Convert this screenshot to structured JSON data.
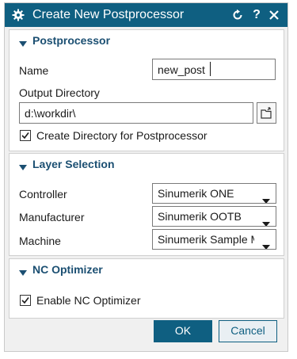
{
  "dialog": {
    "title": "Create New Postprocessor",
    "help_label": "?",
    "accent_color": "#0f5f81"
  },
  "postprocessor": {
    "section_title": "Postprocessor",
    "name_label": "Name",
    "name_value": "new_post",
    "output_dir_label": "Output Directory",
    "output_dir_value": "d:\\workdir\\",
    "create_dir_label": "Create Directory for Postprocessor",
    "create_dir_checked": true
  },
  "layer_selection": {
    "section_title": "Layer Selection",
    "controller_label": "Controller",
    "controller_value": "Sinumerik ONE",
    "manufacturer_label": "Manufacturer",
    "manufacturer_value": "Sinumerik OOTB",
    "machine_label": "Machine",
    "machine_value": "Sinumerik Sample M"
  },
  "nc_optimizer": {
    "section_title": "NC Optimizer",
    "enable_label": "Enable NC Optimizer",
    "enable_checked": true
  },
  "buttons": {
    "ok": "OK",
    "cancel": "Cancel"
  },
  "icons": {
    "title": "gear-icon",
    "reset": "reset-icon",
    "close": "close-icon",
    "browse": "folder-browse-icon"
  }
}
